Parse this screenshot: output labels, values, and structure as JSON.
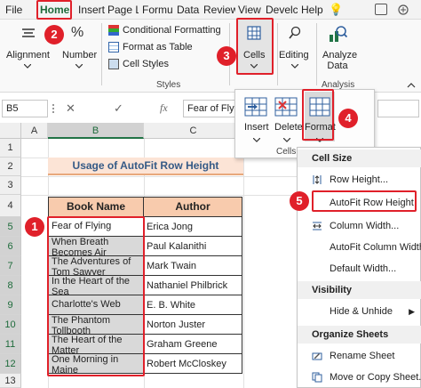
{
  "tabs": [
    "File",
    "Home",
    "Insert",
    "Page L",
    "Formu",
    "Data",
    "Review",
    "View",
    "Develc",
    "Help"
  ],
  "active_tab": "Home",
  "ribbon": {
    "alignment": "Alignment",
    "number": "Number",
    "number_symbol": "%",
    "conditional_formatting": "Conditional Formatting",
    "format_as_table": "Format as Table",
    "cell_styles": "Cell Styles",
    "styles_group": "Styles",
    "cells": "Cells",
    "editing": "Editing",
    "analyze_data": "Analyze Data",
    "analysis_group": "Analysis"
  },
  "popup": {
    "insert": "Insert",
    "delete": "Delete",
    "format": "Format",
    "group": "Cells"
  },
  "formula_bar": {
    "name_box": "B5",
    "fx": "fx",
    "content": "Fear of Fly"
  },
  "columns": [
    "A",
    "B",
    "C"
  ],
  "rows": [
    "1",
    "2",
    "3",
    "4",
    "5",
    "6",
    "7",
    "8",
    "9",
    "10",
    "11",
    "12",
    "13"
  ],
  "sheet": {
    "title": "Usage of AutoFit Row Height",
    "headers": [
      "Book Name",
      "Author"
    ],
    "books": [
      {
        "name": "Fear of Flying",
        "author": "Erica Jong"
      },
      {
        "name": "When Breath Becomes Air",
        "author": "Paul Kalanithi"
      },
      {
        "name": "The Adventures of Tom Sawyer",
        "author": "Mark Twain"
      },
      {
        "name": "In the Heart of the Sea",
        "author": "Nathaniel Philbrick"
      },
      {
        "name": "Charlotte's Web",
        "author": "E. B. White"
      },
      {
        "name": "The Phantom Tollbooth",
        "author": "Norton Juster"
      },
      {
        "name": "The Heart of the Matter",
        "author": "Graham Greene"
      },
      {
        "name": "One Morning in Maine",
        "author": "Robert McCloskey"
      }
    ]
  },
  "menu": {
    "cell_size": "Cell Size",
    "row_height": "Row Height...",
    "autofit_row_height": "AutoFit Row Height",
    "column_width": "Column Width...",
    "autofit_column_width": "AutoFit Column Width",
    "default_width": "Default Width...",
    "visibility": "Visibility",
    "hide_unhide": "Hide & Unhide",
    "organize_sheets": "Organize Sheets",
    "rename_sheet": "Rename Sheet",
    "move_copy": "Move or Copy Sheet..."
  },
  "badges": [
    "1",
    "2",
    "3",
    "4",
    "5"
  ],
  "colors": {
    "accent_green": "#217346",
    "title_fill": "#fce4d6",
    "header_fill": "#f8cbad",
    "highlight_red": "#e0202a"
  }
}
